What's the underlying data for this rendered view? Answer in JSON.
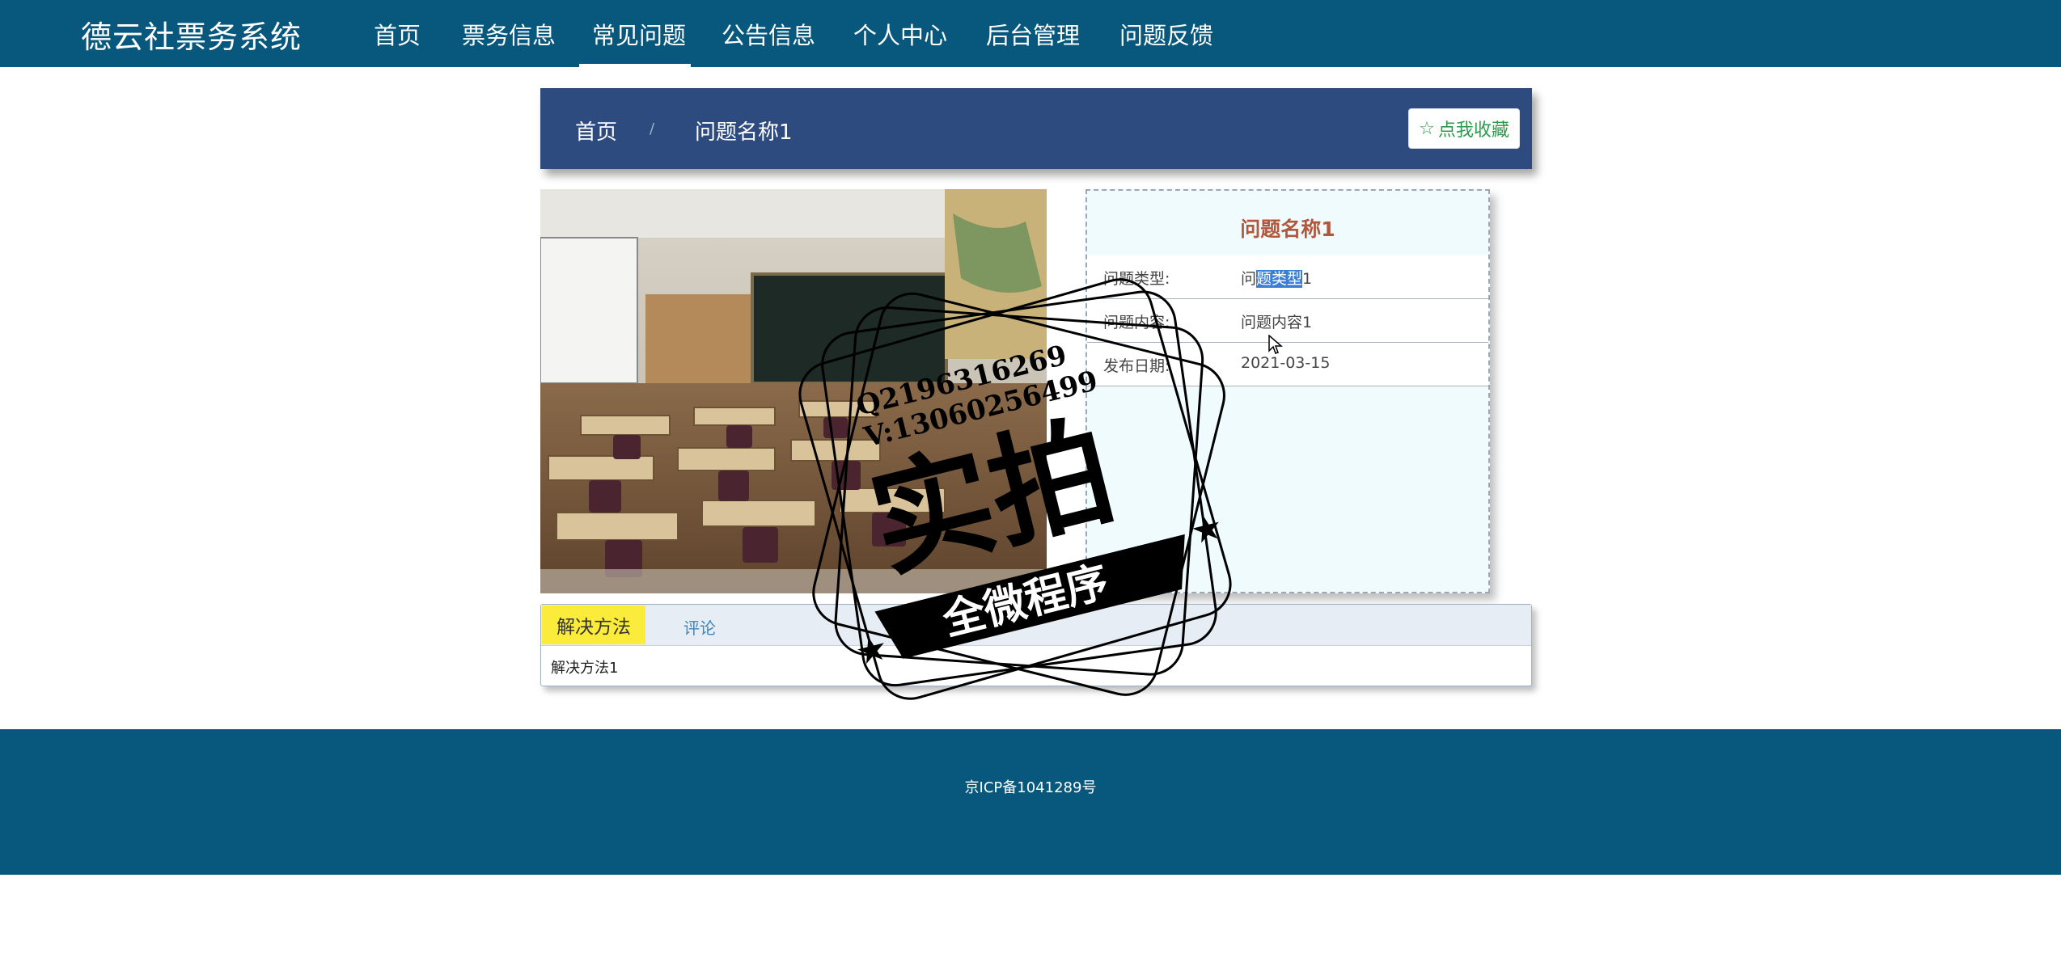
{
  "site": {
    "brand": "德云社票务系统"
  },
  "nav": {
    "items": [
      {
        "label": "首页"
      },
      {
        "label": "票务信息"
      },
      {
        "label": "常见问题",
        "active": true
      },
      {
        "label": "公告信息"
      },
      {
        "label": "个人中心"
      },
      {
        "label": "后台管理"
      },
      {
        "label": "问题反馈"
      }
    ]
  },
  "breadcrumb": {
    "home": "首页",
    "separator": "/",
    "current": "问题名称1"
  },
  "favorite_button": {
    "icon": "star-outline-icon",
    "label": "点我收藏"
  },
  "detail": {
    "title": "问题名称1",
    "rows": [
      {
        "label": "问题类型:",
        "value_pre": "问",
        "value_sel": "题类型",
        "value_post": "1"
      },
      {
        "label": "问题内容:",
        "value": "问题内容1"
      },
      {
        "label": "发布日期:",
        "value": "2021-03-15"
      }
    ]
  },
  "tabs": {
    "items": [
      {
        "label": "解决方法",
        "active": true
      },
      {
        "label": "评论"
      }
    ],
    "content": "解决方法1"
  },
  "watermark": {
    "lines": [
      "Q2196316269",
      "V:13060256499"
    ],
    "main": "实拍",
    "banner": "全微程序"
  },
  "footer": {
    "text": "京ICP备1041289号"
  },
  "colors": {
    "nav_bg": "#08577c",
    "breadcrumb_bg": "#2e4b7f",
    "title": "#b0573d",
    "tab_active": "#fbec3c",
    "fav_text": "#2e9a4e"
  }
}
